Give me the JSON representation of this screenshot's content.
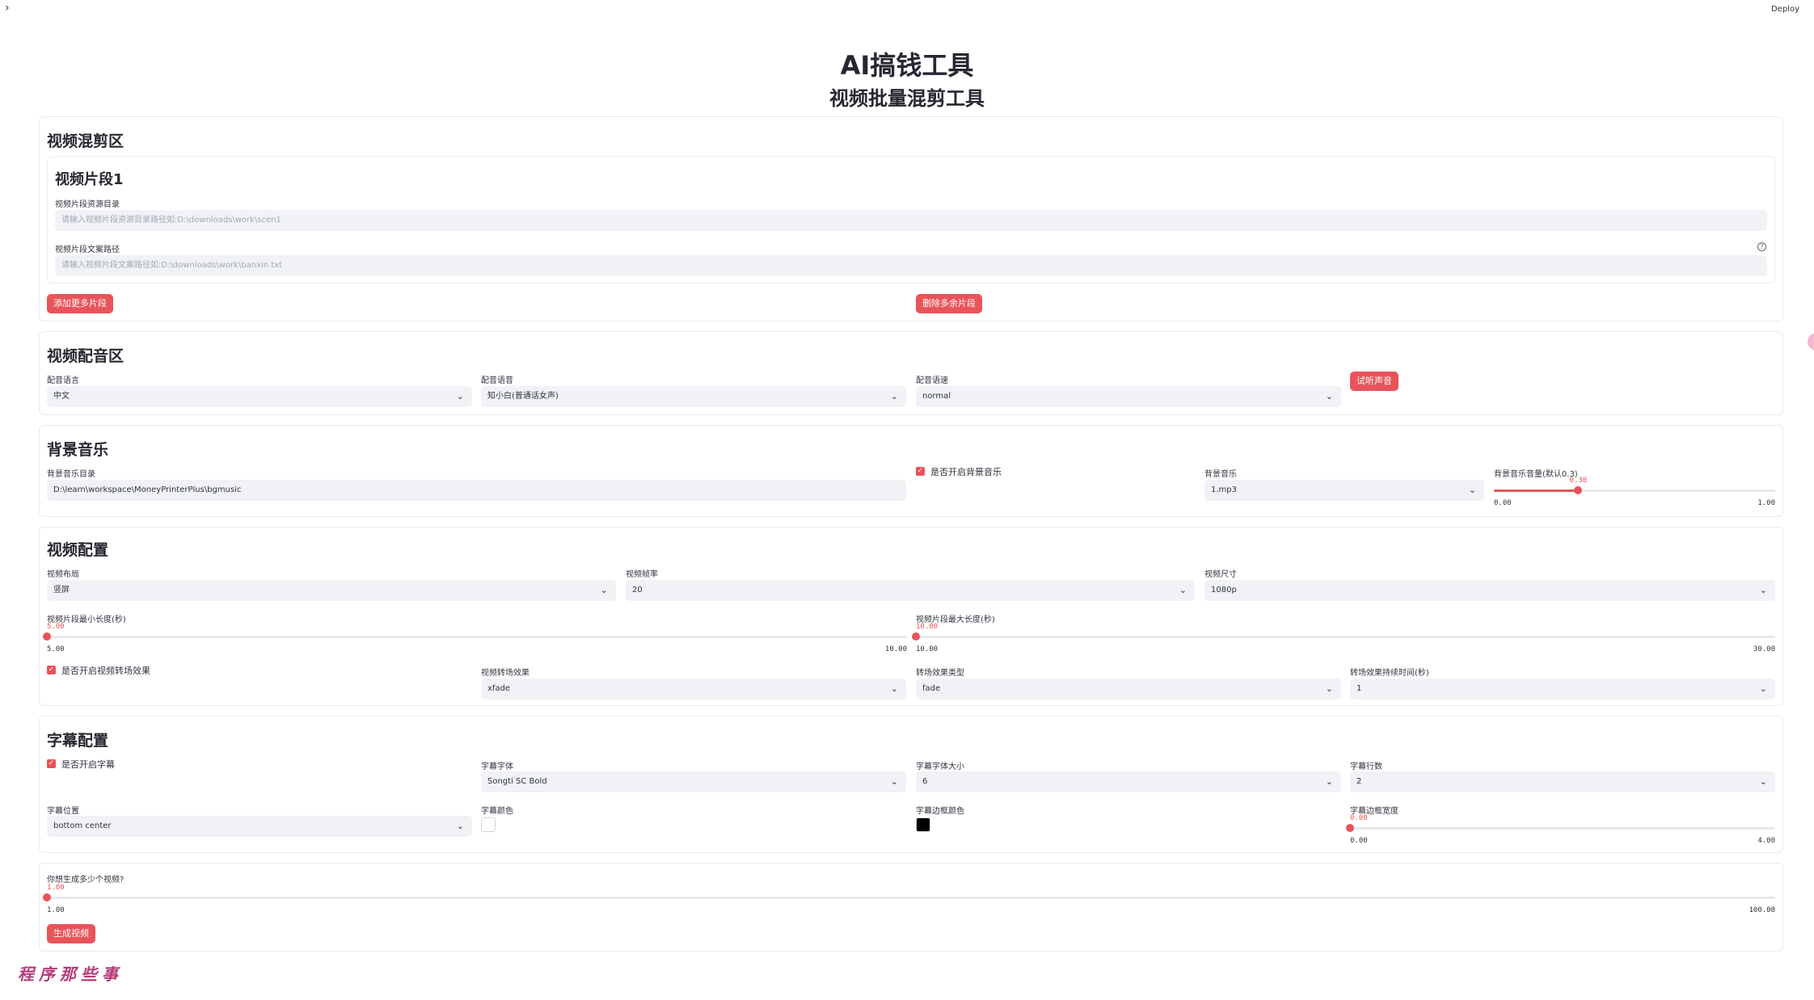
{
  "app": {
    "deploy_label": "Deploy",
    "sidebar_toggle_icon": "chevron-right-icon",
    "title": "AI搞钱工具",
    "subtitle": "视频批量混剪工具",
    "watermark": "程序那些事",
    "accent_color": "#e8545a"
  },
  "mix": {
    "heading": "视频混剪区",
    "segment_heading": "视频片段1",
    "resource_dir_label": "视频片段资源目录",
    "resource_dir_placeholder": "请输入视频片段资源目录路径如:D:\\downloads\\work\\scen1",
    "resource_dir_value": "",
    "copy_path_label": "视频片段文案路径",
    "copy_path_placeholder": "请输入视频片段文案路径如:D:\\downloads\\work\\banxin.txt",
    "copy_path_value": "",
    "add_button": "添加更多片段",
    "remove_button": "删除多余片段"
  },
  "voice": {
    "heading": "视频配音区",
    "language_label": "配音语言",
    "language_value": "中文",
    "voice_label": "配音语音",
    "voice_value": "知小白(普通话女声)",
    "speed_label": "配音语速",
    "speed_value": "normal",
    "preview_button": "试听声音"
  },
  "bgm": {
    "heading": "背景音乐",
    "dir_label": "背景音乐目录",
    "dir_value": "D:\\learn\\workspace\\MoneyPrinterPlus\\bgmusic",
    "enable_label": "是否开启背景音乐",
    "enable_checked": true,
    "music_label": "背景音乐",
    "music_value": "1.mp3",
    "volume_label": "背景音乐音量(默认0.3)",
    "volume_value": "0.30",
    "volume_min": "0.00",
    "volume_max": "1.00",
    "volume_fraction": 0.3
  },
  "video": {
    "heading": "视频配置",
    "layout_label": "视频布局",
    "layout_value": "竖屏",
    "fps_label": "视频帧率",
    "fps_value": "20",
    "size_label": "视频尺寸",
    "size_value": "1080p",
    "min_len_label": "视频片段最小长度(秒)",
    "min_len_value": "5.00",
    "min_len_min": "5.00",
    "min_len_max": "10.00",
    "min_len_fraction": 0,
    "max_len_label": "视频片段最大长度(秒)",
    "max_len_value": "10.00",
    "max_len_min": "10.00",
    "max_len_max": "30.00",
    "max_len_fraction": 0,
    "transition_enable_label": "是否开启视频转场效果",
    "transition_enable_checked": true,
    "transition_label": "视频转场效果",
    "transition_value": "xfade",
    "transition_type_label": "转场效果类型",
    "transition_type_value": "fade",
    "transition_duration_label": "转场效果持续时间(秒)",
    "transition_duration_value": "1"
  },
  "subtitle": {
    "heading": "字幕配置",
    "enable_label": "是否开启字幕",
    "enable_checked": true,
    "font_label": "字幕字体",
    "font_value": "Songti SC Bold",
    "font_size_label": "字幕字体大小",
    "font_size_value": "6",
    "lines_label": "字幕行数",
    "lines_value": "2",
    "position_label": "字幕位置",
    "position_value": "bottom center",
    "color_label": "字幕颜色",
    "color_value": "#ffffff",
    "border_color_label": "字幕边框颜色",
    "border_color_value": "#000000",
    "border_width_label": "字幕边框宽度",
    "border_width_value": "0.00",
    "border_width_min": "0.00",
    "border_width_max": "4.00",
    "border_width_fraction": 0
  },
  "generate": {
    "count_label": "你想生成多少个视频?",
    "count_value": "1.00",
    "count_min": "1.00",
    "count_max": "100.00",
    "count_fraction": 0,
    "button": "生成视频"
  }
}
